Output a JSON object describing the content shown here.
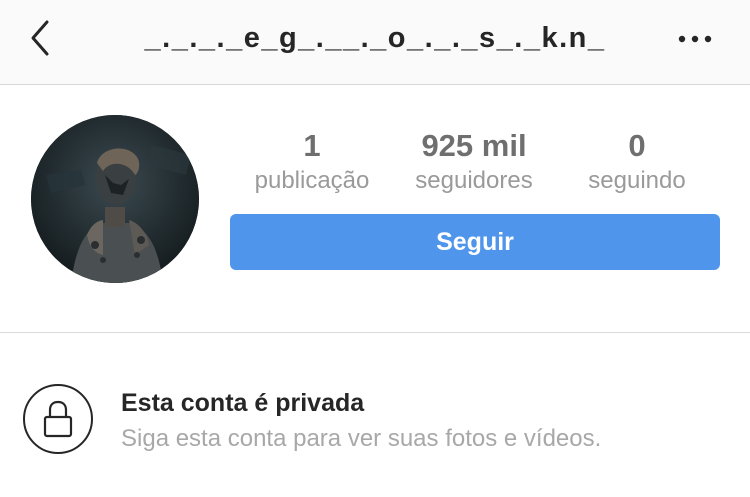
{
  "header": {
    "title": "_._._._e_g_.__._o_._._s_._k.n_",
    "back_icon": "chevron-left-icon",
    "more_icon": "more-horizontal-icon"
  },
  "profile": {
    "avatar": "profile-photo",
    "stats": [
      {
        "value": "1",
        "label": "publicação"
      },
      {
        "value": "925 mil",
        "label": "seguidores"
      },
      {
        "value": "0",
        "label": "seguindo"
      }
    ],
    "follow_label": "Seguir"
  },
  "private_notice": {
    "icon": "lock-icon",
    "title": "Esta conta é privada",
    "subtitle": "Siga esta conta para ver suas fotos e vídeos."
  },
  "colors": {
    "follow_button": "#5095ec",
    "header_bg": "#fafafa",
    "text": "#262626",
    "muted": "#9a9a9a"
  }
}
